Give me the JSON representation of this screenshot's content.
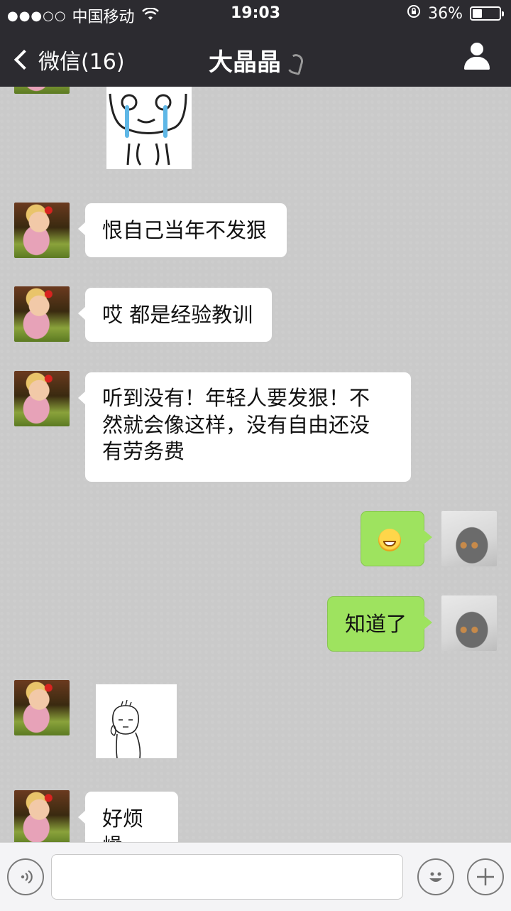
{
  "status_bar": {
    "signal": "●●●○○",
    "carrier": "中国移动",
    "time": "19:03",
    "battery_text": "36%",
    "battery_level": 0.36
  },
  "nav": {
    "back_label": "微信(16)",
    "title": "大晶晶"
  },
  "messages": [
    {
      "side": "left",
      "type": "text",
      "text": "恨自己当年不发狠"
    },
    {
      "side": "left",
      "type": "text",
      "text": "哎 都是经验教训"
    },
    {
      "side": "left",
      "type": "text",
      "line1": "听到没有！年轻人要发狠！不",
      "line2": "然就会像这样，没有自由还没",
      "line3": "有劳务费"
    },
    {
      "side": "right",
      "type": "emoji",
      "icon": "grinning-face-icon"
    },
    {
      "side": "right",
      "type": "text",
      "text": "知道了"
    },
    {
      "side": "left",
      "type": "sticker",
      "icon": "thinking-doodle-sticker"
    },
    {
      "side": "left",
      "type": "text",
      "text": "好烦燥"
    }
  ],
  "input": {
    "placeholder": ""
  },
  "colors": {
    "bar_bg": "#2c2b30",
    "chat_bg": "#cacaca",
    "my_bubble": "#9ee35f",
    "their_bubble": "#ffffff"
  }
}
